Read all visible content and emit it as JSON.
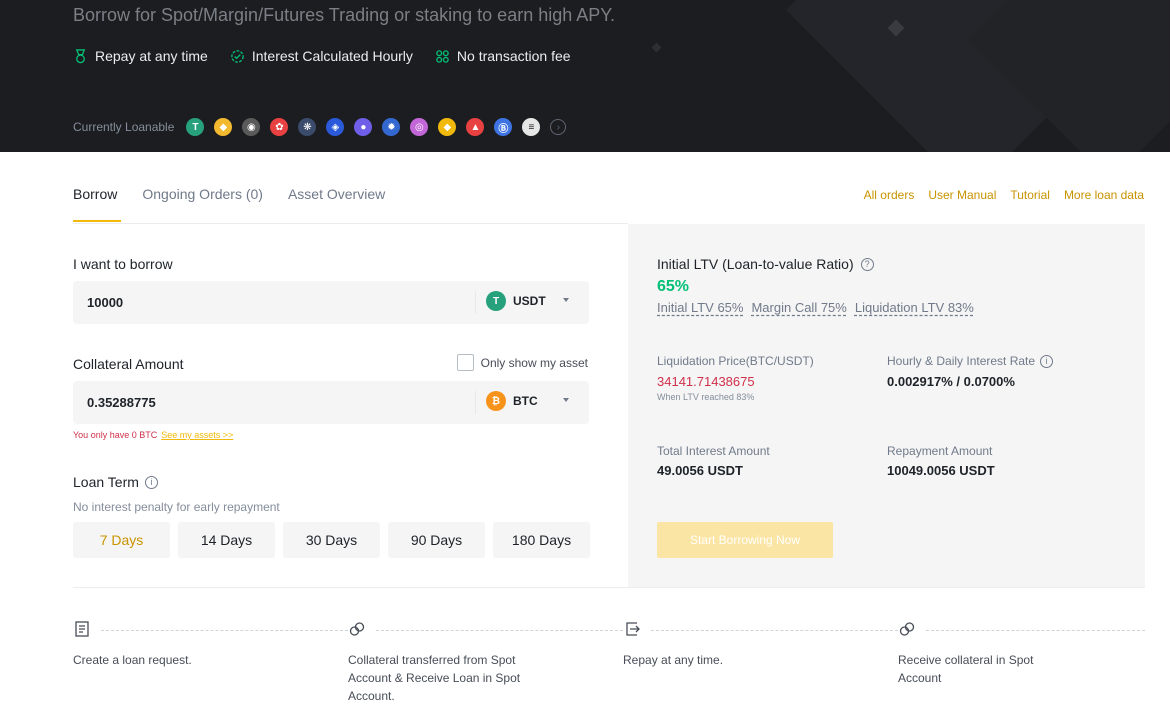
{
  "hero": {
    "subtitle": "Borrow for Spot/Margin/Futures Trading or staking to earn high APY.",
    "features": [
      {
        "icon": "medal-icon",
        "label": "Repay at any time"
      },
      {
        "icon": "clock-check-icon",
        "label": "Interest Calculated Hourly"
      },
      {
        "icon": "percent-icon",
        "label": "No transaction fee"
      }
    ],
    "loanable_label": "Currently Loanable",
    "coins": [
      {
        "name": "usdt-coin-icon",
        "color": "#26a17b",
        "glyph": "T"
      },
      {
        "name": "bnb-coin-icon",
        "color": "#f3ba2f",
        "glyph": "◆"
      },
      {
        "name": "coin-icon-3",
        "color": "#5a5a5a",
        "glyph": "◉"
      },
      {
        "name": "coin-icon-4",
        "color": "#e84142",
        "glyph": "✿"
      },
      {
        "name": "coin-icon-5",
        "color": "#3b4b6b",
        "glyph": "❋"
      },
      {
        "name": "coin-icon-6",
        "color": "#2a5ada",
        "glyph": "◈"
      },
      {
        "name": "coin-icon-7",
        "color": "#6e5ee8",
        "glyph": "●"
      },
      {
        "name": "coin-icon-8",
        "color": "#3468d1",
        "glyph": "✹"
      },
      {
        "name": "coin-icon-9",
        "color": "#c266d8",
        "glyph": "◎"
      },
      {
        "name": "coin-icon-10",
        "color": "#f0b90b",
        "glyph": "◆"
      },
      {
        "name": "coin-icon-11",
        "color": "#e84142",
        "glyph": "▲"
      },
      {
        "name": "coin-icon-12",
        "color": "#3e73e4",
        "glyph": "Ⓑ"
      },
      {
        "name": "coin-icon-13",
        "color": "#e6e6e6",
        "glyph": "≡"
      }
    ]
  },
  "tabs": [
    {
      "label": "Borrow"
    },
    {
      "label": "Ongoing Orders (0)"
    },
    {
      "label": "Asset Overview"
    }
  ],
  "links": [
    "All orders",
    "User Manual",
    "Tutorial",
    "More loan data"
  ],
  "form": {
    "borrow_label": "I want to borrow",
    "borrow_value": "10000",
    "borrow_asset": "USDT",
    "collateral_label": "Collateral Amount",
    "only_show_label": "Only show my asset",
    "collateral_value": "0.35288775",
    "collateral_asset": "BTC",
    "warning": "You only have 0 BTC",
    "warning_link": "See my assets >>",
    "term_label": "Loan Term",
    "term_hint": "No interest penalty for early repayment",
    "terms": [
      "7 Days",
      "14 Days",
      "30 Days",
      "90 Days",
      "180 Days"
    ],
    "selected_term": "7 Days"
  },
  "summary": {
    "ltv_title": "Initial LTV (Loan-to-value Ratio)",
    "ltv_value": "65%",
    "initial_ltv": "Initial LTV 65%",
    "margin_call": "Margin Call 75%",
    "liquidation_ltv": "Liquidation LTV 83%",
    "liq_price_label": "Liquidation Price(BTC/USDT)",
    "liq_price_value": "34141.71438675",
    "liq_price_note": "When LTV reached 83%",
    "rate_label": "Hourly & Daily Interest Rate",
    "rate_value": "0.002917% / 0.0700%",
    "total_interest_label": "Total Interest Amount",
    "total_interest_value": "49.0056 USDT",
    "repayment_label": "Repayment Amount",
    "repayment_value": "10049.0056 USDT",
    "start_button": "Start Borrowing Now"
  },
  "steps": [
    {
      "icon": "receipt-icon",
      "text": "Create a loan request."
    },
    {
      "icon": "link-icon",
      "text": "Collateral transferred from Spot Account & Receive Loan in Spot Account."
    },
    {
      "icon": "repay-icon",
      "text": "Repay at any time."
    },
    {
      "icon": "link-icon",
      "text": "Receive collateral in Spot Account"
    }
  ]
}
